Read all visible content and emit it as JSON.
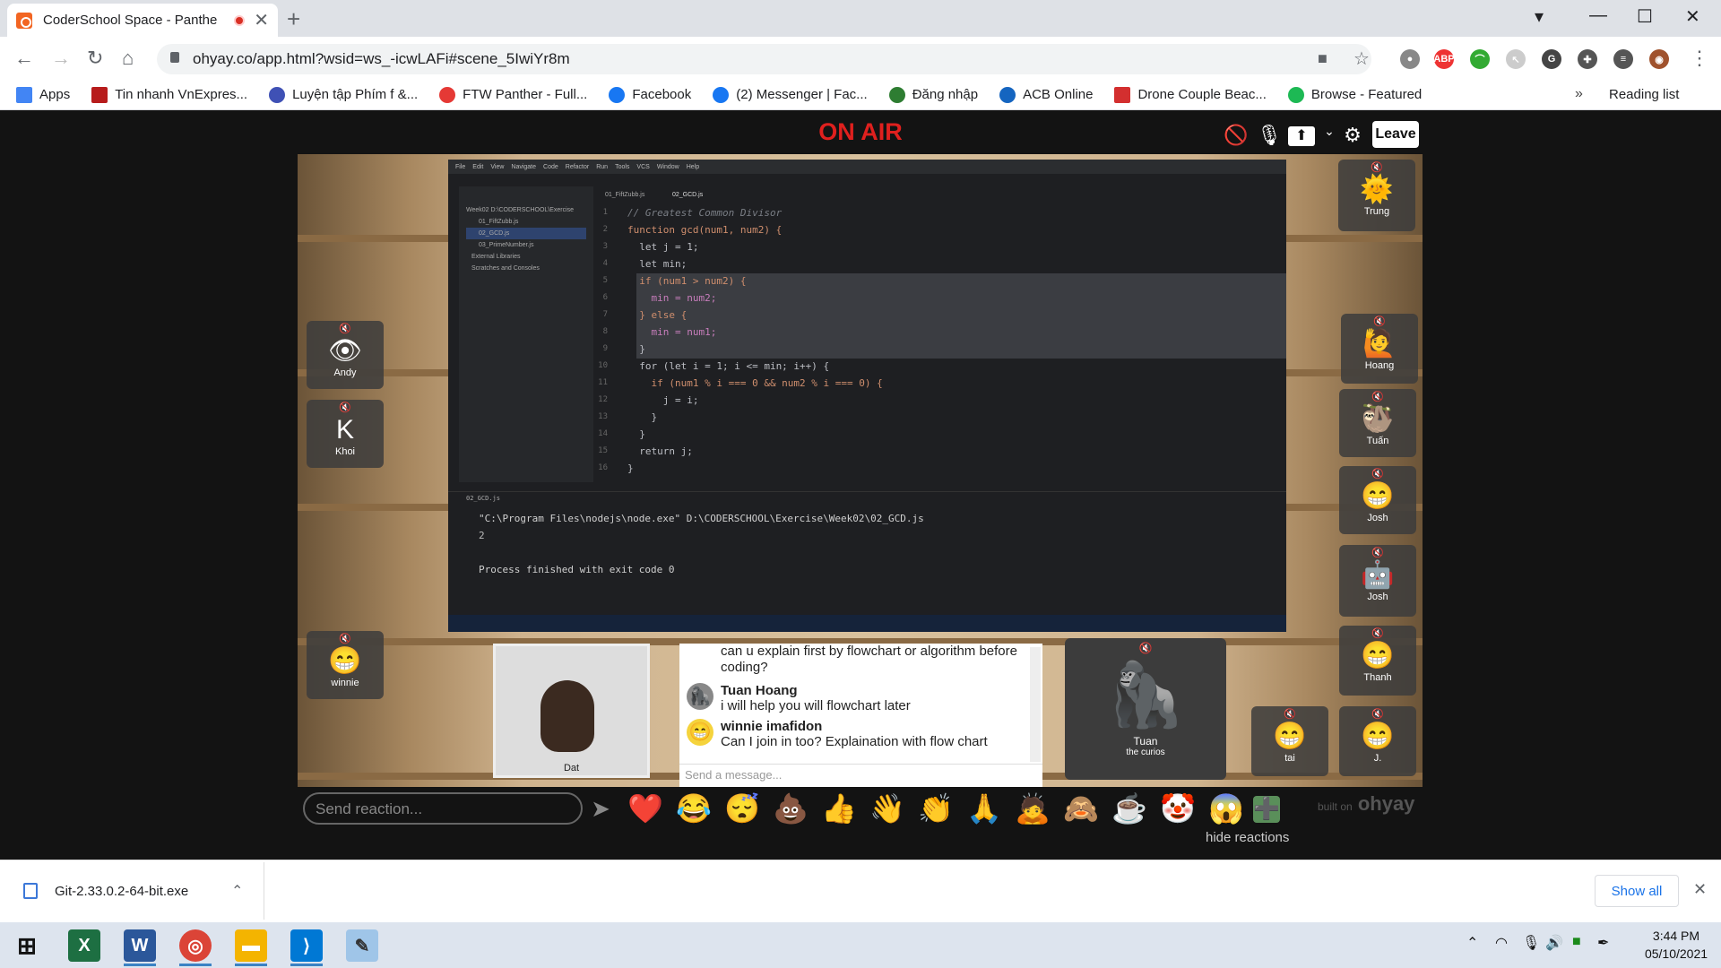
{
  "browser": {
    "tab_title": "CoderSchool Space - Panthe",
    "url": "ohyay.co/app.html?wsid=ws_-icwLAFi#scene_5IwiYr8m",
    "bookmarks": [
      "Apps",
      "Tin nhanh VnExpres...",
      "Luyện tập Phím f &...",
      "FTW Panther - Full...",
      "Facebook",
      "(2) Messenger | Fac...",
      "Đăng nhập",
      "ACB Online",
      "Drone Couple Beac...",
      "Browse - Featured"
    ],
    "reading_list": "Reading list",
    "more": "»"
  },
  "app": {
    "on_air": "ON AIR",
    "leave": "Leave",
    "reaction_placeholder": "Send reaction...",
    "hide_reactions": "hide reactions",
    "built_on": "built on",
    "brand": "ohyay"
  },
  "ide": {
    "menu": [
      "File",
      "Edit",
      "View",
      "Navigate",
      "Code",
      "Refactor",
      "Run",
      "Tools",
      "VCS",
      "Window",
      "Help"
    ],
    "files": [
      "Week02 D:\\CODERSCHOOL\\Exercise",
      "01_FiftZubb.js",
      "02_GCD.js",
      "03_PrimeNumber.js",
      "External Libraries",
      "Scratches and Consoles"
    ],
    "tabs": [
      "01_FiftZubb.js",
      "02_GCD.js"
    ],
    "line_numbers": [
      "1",
      "2",
      "3",
      "4",
      "5",
      "6",
      "7",
      "8",
      "9",
      "10",
      "11",
      "12",
      "13",
      "14",
      "15",
      "16"
    ],
    "code": [
      "// Greatest Common Divisor",
      "function gcd(num1, num2) {",
      "  let j = 1;",
      "  let min;",
      "  if (num1 > num2) {",
      "    min = num2;",
      "  } else {",
      "    min = num1;",
      "  }",
      "  for (let i = 1; i <= min; i++) {",
      "    if (num1 % i === 0 && num2 % i === 0) {",
      "      j = i;",
      "    }",
      "  }",
      "  return j;",
      "}"
    ],
    "run_tab": "02_GCD.js",
    "terminal": [
      "\"C:\\Program Files\\nodejs\\node.exe\" D:\\CODERSCHOOL\\Exercise\\Week02\\02_GCD.js",
      "2",
      "",
      "Process finished with exit code 0"
    ]
  },
  "participants": [
    {
      "name": "Trung",
      "face": "🌞"
    },
    {
      "name": "Andy",
      "face": "👁"
    },
    {
      "name": "Khoi",
      "face": "K"
    },
    {
      "name": "Hoang",
      "face": "🙋"
    },
    {
      "name": "Tuấn",
      "face": "🦥"
    },
    {
      "name": "Josh",
      "face": "😁"
    },
    {
      "name": "Josh",
      "face": "🤖"
    },
    {
      "name": "winnie",
      "face": "😁"
    },
    {
      "name": "Thanh",
      "face": "😁"
    },
    {
      "name": "tai",
      "face": "😁"
    },
    {
      "name": "J.",
      "face": "😁"
    }
  ],
  "camera": {
    "name": "Dat"
  },
  "tuan_tile": {
    "name": "Tuan",
    "sub": "the curios"
  },
  "chat": {
    "partial": "can u explain first by flowchart or algorithm before coding?",
    "messages": [
      {
        "author": "Tuan Hoang",
        "text": "i will help you will flowchart later"
      },
      {
        "author": "winnie imafidon",
        "text": "Can I join in too? Explaination with flow chart"
      }
    ],
    "input_placeholder": "Send a message..."
  },
  "reactions": [
    "❤️",
    "😂",
    "😴",
    "💩",
    "👍",
    "👋",
    "👏",
    "🙏",
    "🙇",
    "🙈",
    "☕",
    "🤡",
    "😱",
    "➕"
  ],
  "download": {
    "file": "Git-2.33.0.2-64-bit.exe",
    "show_all": "Show all"
  },
  "taskbar": {
    "time": "3:44 PM",
    "date": "05/10/2021"
  }
}
